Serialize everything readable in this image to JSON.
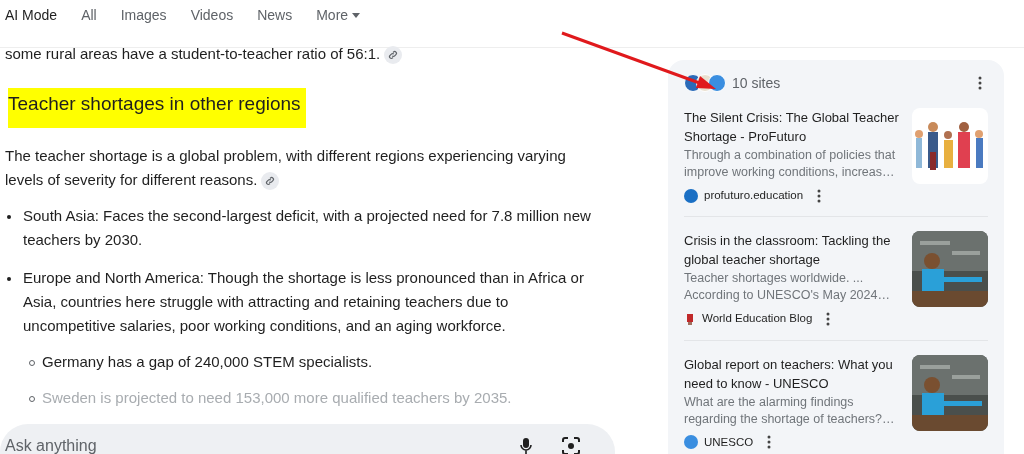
{
  "tabs": [
    {
      "label": "AI Mode",
      "selected": true
    },
    {
      "label": "All",
      "selected": false
    },
    {
      "label": "Images",
      "selected": false
    },
    {
      "label": "Videos",
      "selected": false
    },
    {
      "label": "News",
      "selected": false
    },
    {
      "label": "More",
      "selected": false,
      "dropdown": true
    }
  ],
  "answer": {
    "intro_tail": "some rural areas have a student-to-teacher ratio of 56:1.",
    "heading": "Teacher shortages in other regions",
    "paragraph": "The teacher shortage is a global problem, with different regions experiencing varying levels of severity for different reasons.",
    "bullets": [
      {
        "text": "South Asia: Faces the second-largest deficit, with a projected need for 7.8 million new teachers by 2030.",
        "faded": false
      },
      {
        "text": "Europe and North America: Though the shortage is less pronounced than in Africa or Asia, countries here struggle with attracting and retaining teachers due to uncompetitive salaries, poor working conditions, and an aging workforce.",
        "faded": false,
        "children": [
          {
            "text": "Germany has a gap of 240,000 STEM specialists.",
            "faded": false
          },
          {
            "text": "Sweden is projected to need 153,000 more qualified teachers by 2035.",
            "faded": true
          }
        ]
      }
    ]
  },
  "ask_bar": {
    "placeholder": "Ask anything"
  },
  "sources": {
    "count": "10 sites",
    "items": [
      {
        "title": "The Silent Crisis: The Global Teacher Shortage - ProFuturo",
        "snippet": "Through a combination of policies that improve working conditions, increas…",
        "site": "profuturo.education"
      },
      {
        "title": "Crisis in the classroom: Tackling the global teacher shortage",
        "snippet": "Teacher shortages worldwide. ... According to UNESCO's May 2024…",
        "site": "World Education Blog"
      },
      {
        "title": "Global report on teachers: What you need to know - UNESCO",
        "snippet": "What are the alarming findings regarding the shortage of teachers?…",
        "site": "UNESCO"
      }
    ]
  }
}
